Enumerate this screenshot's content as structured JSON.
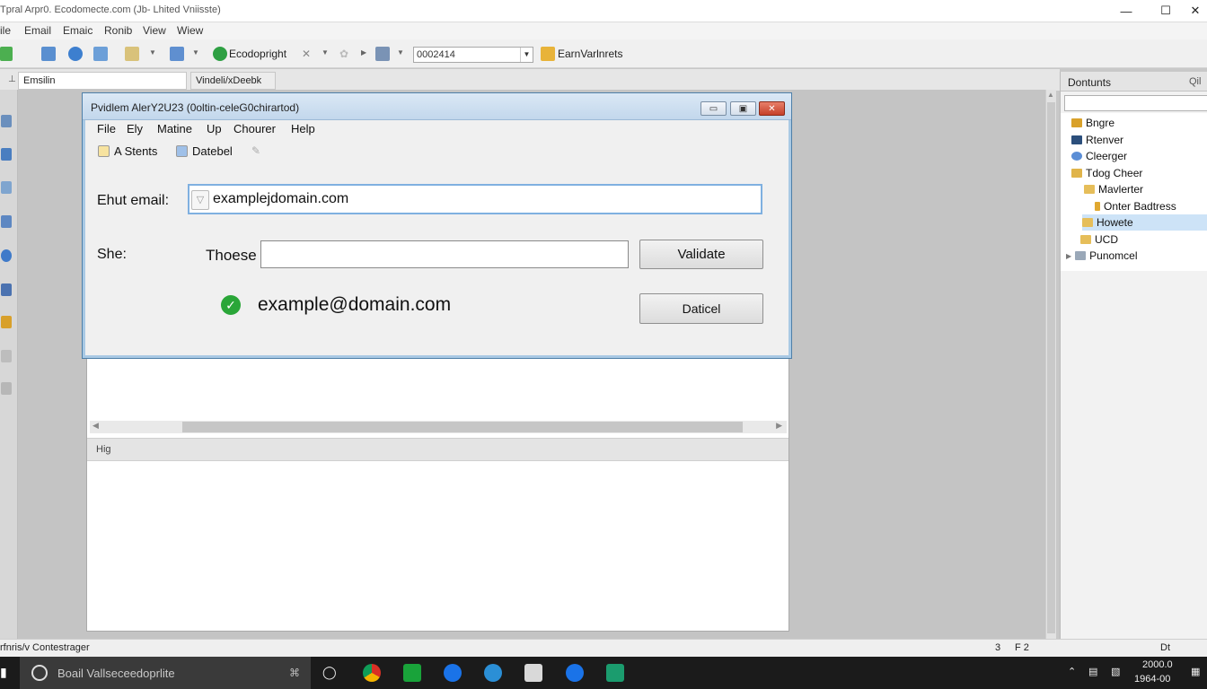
{
  "window": {
    "title": "Tpral Arpr0. Ecodomecte.com (Jb- Lhited Vniisste)",
    "minimize": "—",
    "maximize": "☐",
    "close": "✕"
  },
  "menubar": [
    "ile",
    "Email",
    "Emaic",
    "Ronib",
    "View",
    "Wiew"
  ],
  "toolbar": {
    "copyright_label": "Ecodopright",
    "combo_value": "0002414",
    "bookmarks_label": "EarnVarlnrets"
  },
  "tabs": [
    "Emsilin",
    "Vindeli/xDeebk"
  ],
  "right_panel": {
    "tabs": [
      "Dontunts",
      "Qil"
    ],
    "tree": [
      {
        "label": "Bngre",
        "icon_color": "#d9a12a"
      },
      {
        "label": "Rtenver",
        "icon_color": "#2c4f7c"
      },
      {
        "label": "Cleerger",
        "icon_color": "#5b8ed6"
      },
      {
        "label": "Tdog Cheer",
        "icon_color": "#e0b44a"
      },
      {
        "label": "Mavlerter",
        "icon_color": "#e6be5a"
      },
      {
        "label": "Onter Badtress",
        "icon_color": "#e0a830"
      },
      {
        "label": "Howete",
        "icon_color": "#e6be5a"
      },
      {
        "label": "UCD",
        "icon_color": "#e6be5a"
      },
      {
        "label": "Punomcel",
        "icon_color": "#9aa8b8"
      }
    ]
  },
  "document": {
    "subheader": "Hig"
  },
  "dialog": {
    "title": "Pvidlem AlerY2U23 (0oltin-celeG0chirartod)",
    "menu": [
      "File",
      "Ely",
      "Matine",
      "Up",
      "Chourer",
      "Help"
    ],
    "toolbar": [
      "A Stents",
      "Datebel"
    ],
    "email_label": "Ehut email:",
    "email_value": "examplejdomain.com",
    "she_label": "She:",
    "these_label": "Thoese",
    "validate_label": "Validate",
    "cancel_label": "Daticel",
    "result_text": "example@domain.com"
  },
  "statusbar": {
    "left": "rfnris/v Contestrager",
    "pages": "3",
    "page_sep": "F 2",
    "mode": "Dt"
  },
  "taskbar": {
    "search_placeholder": "Boail Vallseceedoprlite",
    "time": "2000.0",
    "date": "1964-00"
  },
  "colors": {
    "accent": "#4e7fa8",
    "success": "#2aa638",
    "selection": "#cde3f7"
  }
}
